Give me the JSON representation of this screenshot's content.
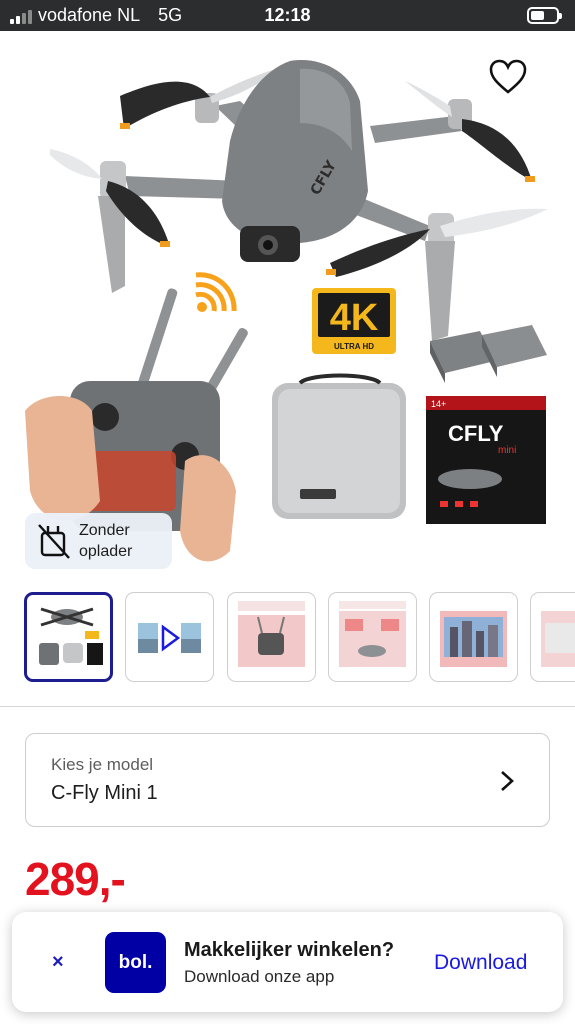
{
  "status_bar": {
    "carrier": "vodafone NL",
    "network": "5G",
    "time": "12:18"
  },
  "product": {
    "hero_badge": {
      "line1": "Zonder",
      "line2": "oplader",
      "icon": "no-charger-icon"
    },
    "favorite_icon": "heart-outline-icon",
    "image_labels": {
      "resolution_badge_big": "4K",
      "resolution_badge_small": "ULTRA HD",
      "box_brand": "CFLY",
      "box_model": "mini",
      "box_age": "14+"
    },
    "thumbnail_count": 6,
    "model_selector": {
      "label": "Kies je model",
      "value": "C-Fly Mini 1",
      "icon": "chevron-right-icon"
    },
    "price": "289,-"
  },
  "app_banner": {
    "close_label": "×",
    "logo_text": "bol.",
    "title": "Makkelijker winkelen?",
    "subtitle": "Download onze app",
    "action_label": "Download"
  },
  "colors": {
    "price": "#e2121f",
    "brand_blue": "#0000a4",
    "link_blue": "#1a1ae0",
    "active_thumb_border": "#1d1d8f"
  }
}
